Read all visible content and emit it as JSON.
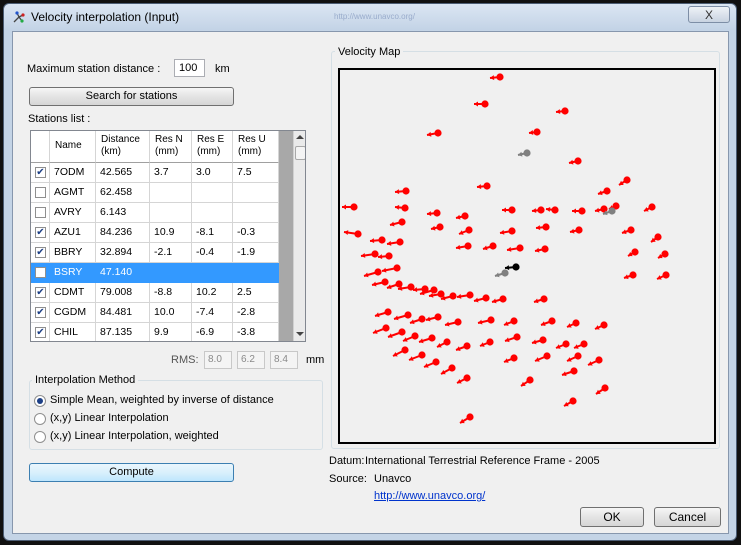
{
  "window": {
    "title": "Velocity interpolation (Input)",
    "blur_text": "http://www.unavco.org/",
    "close_label": "X"
  },
  "form": {
    "max_distance_label": "Maximum station distance :",
    "max_distance_value": "100",
    "max_distance_unit": "km",
    "search_button": "Search for stations",
    "stations_list_label": "Stations list :"
  },
  "stations_table": {
    "columns": [
      {
        "label": "Name"
      },
      {
        "label": "Distance (km)"
      },
      {
        "label": "Res N (mm)"
      },
      {
        "label": "Res E (mm)"
      },
      {
        "label": "Res U (mm)"
      }
    ],
    "rows": [
      {
        "checked": true,
        "name": "7ODM",
        "distance": "42.565",
        "res_n": "3.7",
        "res_e": "3.0",
        "res_u": "7.5",
        "selected": false
      },
      {
        "checked": false,
        "name": "AGMT",
        "distance": "62.458",
        "res_n": "",
        "res_e": "",
        "res_u": "",
        "selected": false
      },
      {
        "checked": false,
        "name": "AVRY",
        "distance": "6.143",
        "res_n": "",
        "res_e": "",
        "res_u": "",
        "selected": false
      },
      {
        "checked": true,
        "name": "AZU1",
        "distance": "84.236",
        "res_n": "10.9",
        "res_e": "-8.1",
        "res_u": "-0.3",
        "selected": false
      },
      {
        "checked": true,
        "name": "BBRY",
        "distance": "32.894",
        "res_n": "-2.1",
        "res_e": "-0.4",
        "res_u": "-1.9",
        "selected": false
      },
      {
        "checked": false,
        "name": "BSRY",
        "distance": "47.140",
        "res_n": "",
        "res_e": "",
        "res_u": "",
        "selected": true
      },
      {
        "checked": true,
        "name": "CDMT",
        "distance": "79.008",
        "res_n": "-8.8",
        "res_e": "10.2",
        "res_u": "2.5",
        "selected": false
      },
      {
        "checked": true,
        "name": "CGDM",
        "distance": "84.481",
        "res_n": "10.0",
        "res_e": "-7.4",
        "res_u": "-2.8",
        "selected": false
      },
      {
        "checked": true,
        "name": "CHIL",
        "distance": "87.135",
        "res_n": "9.9",
        "res_e": "-6.9",
        "res_u": "-3.8",
        "selected": false
      }
    ]
  },
  "rms": {
    "label": "RMS:",
    "n": "8.0",
    "e": "6.2",
    "u": "8.4",
    "unit": "mm"
  },
  "interpolation": {
    "title": "Interpolation Method",
    "options": [
      {
        "label": "Simple Mean, weighted by inverse of distance",
        "selected": true
      },
      {
        "label": "(x,y) Linear Interpolation",
        "selected": false
      },
      {
        "label": "(x,y) Linear Interpolation, weighted",
        "selected": false
      }
    ]
  },
  "compute_button": "Compute",
  "map": {
    "title": "Velocity Map",
    "colors": {
      "station": "#ff0000",
      "excluded": "#808080",
      "target": "#000000"
    }
  },
  "info": {
    "datum_label": "Datum:",
    "datum_value": "International Terrestrial Reference Frame - 2005",
    "source_label": "Source:",
    "source_value": "Unavco",
    "url": "http://www.unavco.org/"
  },
  "buttons": {
    "ok": "OK",
    "cancel": "Cancel"
  }
}
